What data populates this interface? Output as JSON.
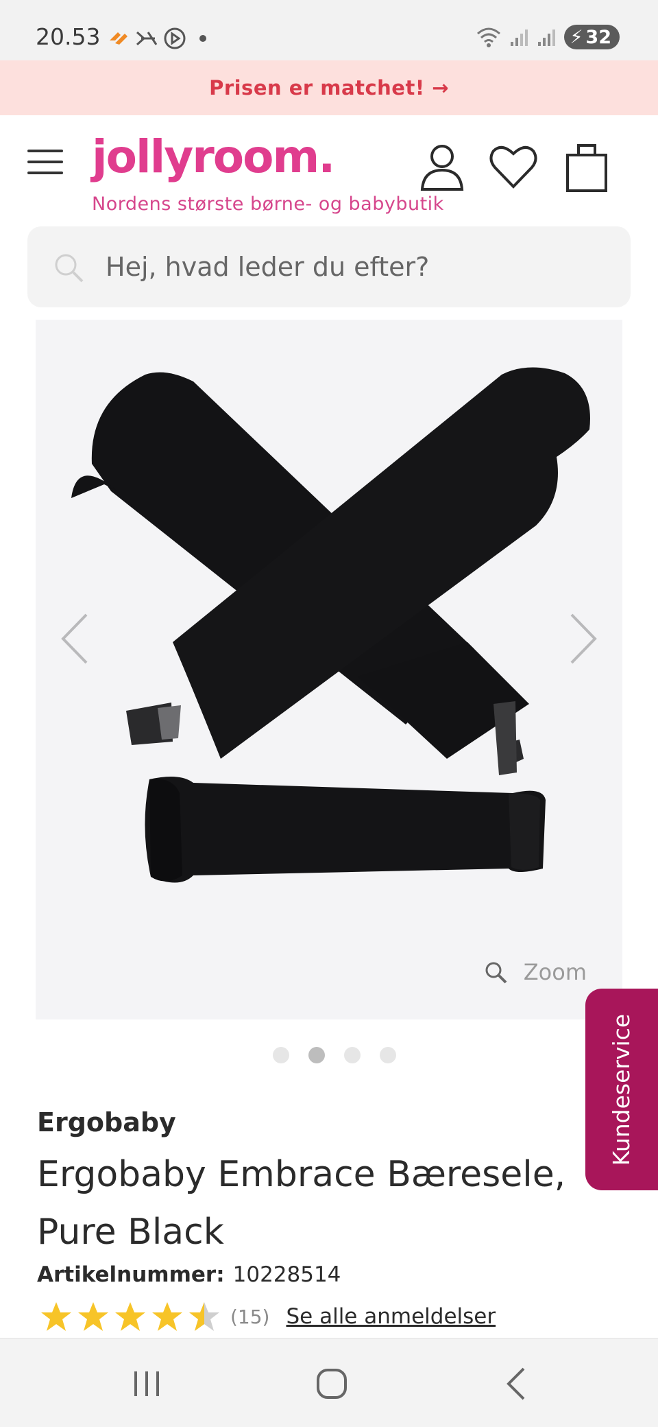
{
  "status_bar": {
    "time": "20.53",
    "battery": "32",
    "icons_left": [
      "app-notification-icon",
      "mute-icon",
      "media-icon",
      "dot-icon"
    ],
    "icons_right": [
      "wifi-icon",
      "signal-icon",
      "signal-icon",
      "battery-icon"
    ]
  },
  "promo": {
    "text": "Prisen er matchet! →"
  },
  "header": {
    "logo": "jollyroom.",
    "tagline": "Nordens største børne- og babybutik",
    "icons": [
      "menu-icon",
      "user-icon",
      "heart-icon",
      "bag-icon"
    ]
  },
  "search": {
    "placeholder": "Hej, hvad leder du efter?"
  },
  "gallery": {
    "zoom_label": "Zoom",
    "slide_count": 4,
    "active_slide": 2
  },
  "kundeservice": {
    "label": "Kundeservice"
  },
  "product": {
    "brand": "Ergobaby",
    "title": "Ergobaby Embrace Bæresele, Pure Black",
    "article_label": "Artikelnummer:",
    "article_number": "10228514",
    "rating": 4.5,
    "review_count": "(15)",
    "reviews_link": "Se alle anmeldelser"
  },
  "colors": {
    "brand_pink": "#e03d8e",
    "promo_bg": "#fde0dd",
    "promo_text": "#d83a4a",
    "kundeservice_bg": "#a8165a",
    "star": "#f7c428"
  },
  "navbar": {
    "buttons": [
      "recents-icon",
      "home-icon",
      "back-icon"
    ]
  }
}
